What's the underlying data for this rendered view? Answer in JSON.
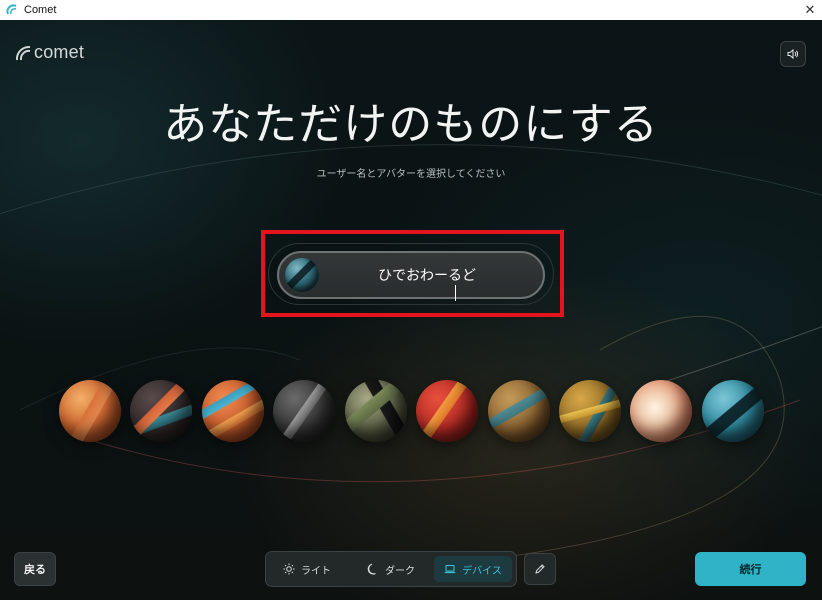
{
  "window": {
    "title": "Comet",
    "close_glyph": "✕"
  },
  "brand": {
    "logo_text": "comet"
  },
  "sound": {
    "icon": "speaker-icon"
  },
  "onboarding": {
    "headline": "あなただけのものにする",
    "subtitle": "ユーザー名とアバターを選択してください",
    "username_value": "ひでおわーるど"
  },
  "avatars": [
    {
      "name": "avatar-orange"
    },
    {
      "name": "avatar-dark-stripe"
    },
    {
      "name": "avatar-orange-blue"
    },
    {
      "name": "avatar-gray"
    },
    {
      "name": "avatar-olive"
    },
    {
      "name": "avatar-red"
    },
    {
      "name": "avatar-bronze"
    },
    {
      "name": "avatar-gold"
    },
    {
      "name": "avatar-pearl"
    },
    {
      "name": "avatar-teal"
    }
  ],
  "footer": {
    "back_label": "戻る",
    "theme_options": [
      {
        "label": "ライト",
        "icon": "sun-icon",
        "selected": false
      },
      {
        "label": "ダーク",
        "icon": "moon-icon",
        "selected": false
      },
      {
        "label": "デバイス",
        "icon": "laptop-icon",
        "selected": true
      }
    ],
    "edit_icon": "pencil-icon",
    "continue_label": "続行"
  },
  "colors": {
    "accent": "#2fb3c7",
    "highlight_box": "#e3141b",
    "background": "#0b1517"
  }
}
